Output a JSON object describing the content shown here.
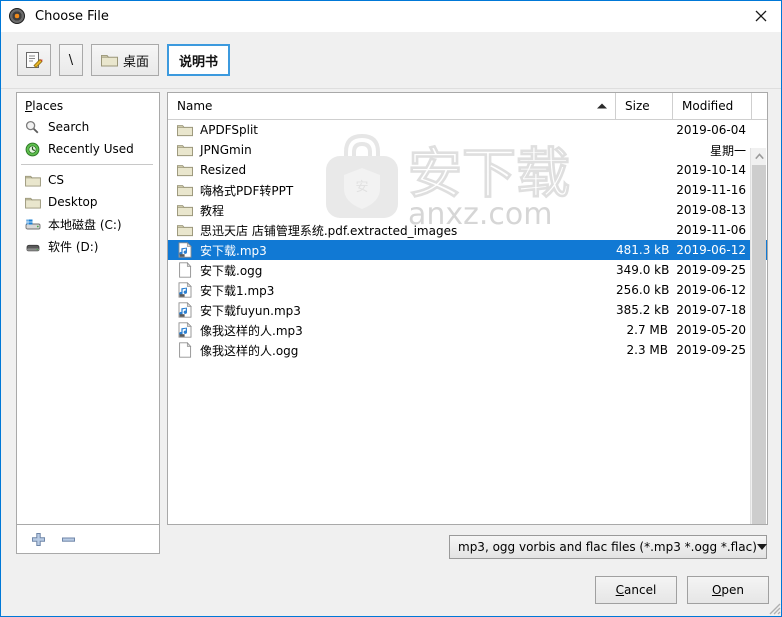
{
  "window": {
    "title": "Choose File",
    "app_icon": "record-disc-icon",
    "close_label": "×"
  },
  "toolbar": {
    "buttons": [
      {
        "name": "type-location-button",
        "icon": "pencil-edit-icon",
        "label": ""
      },
      {
        "name": "path-root-button",
        "icon": "",
        "label": "\\"
      },
      {
        "name": "path-desktop-button",
        "icon": "folder-icon",
        "label": "桌面"
      },
      {
        "name": "path-current-button",
        "icon": "",
        "label": "说明书",
        "active": true
      }
    ]
  },
  "sidebar": {
    "header": "Places",
    "header_accel": "P",
    "items": [
      {
        "label": "Search",
        "icon": "search-icon"
      },
      {
        "label": "Recently Used",
        "icon": "recent-clock-icon"
      },
      {
        "label": "CS",
        "icon": "folder-icon"
      },
      {
        "label": "Desktop",
        "icon": "folder-icon"
      },
      {
        "label": "本地磁盘 (C:)",
        "icon": "harddisk-icon"
      },
      {
        "label": "软件 (D:)",
        "icon": "drive-icon"
      }
    ],
    "add_button": "+",
    "remove_button": "−"
  },
  "filelist": {
    "columns": {
      "name": "Name",
      "size": "Size",
      "modified": "Modified"
    },
    "sort_column": "Name",
    "sort_direction": "ascending",
    "rows": [
      {
        "name": "APDFSplit",
        "size": "",
        "modified": "2019-06-04",
        "icon": "folder-icon",
        "selected": false
      },
      {
        "name": "JPNGmin",
        "size": "",
        "modified": "星期一",
        "icon": "folder-icon",
        "selected": false
      },
      {
        "name": "Resized",
        "size": "",
        "modified": "2019-10-14",
        "icon": "folder-icon",
        "selected": false
      },
      {
        "name": "嗨格式PDF转PPT",
        "size": "",
        "modified": "2019-11-16",
        "icon": "folder-icon",
        "selected": false
      },
      {
        "name": "教程",
        "size": "",
        "modified": "2019-08-13",
        "icon": "folder-icon",
        "selected": false
      },
      {
        "name": "思迅天店 店铺管理系统.pdf.extracted_images",
        "size": "",
        "modified": "2019-11-06",
        "icon": "folder-icon",
        "selected": false
      },
      {
        "name": "安下载.mp3",
        "size": "481.3 kB",
        "modified": "2019-06-12",
        "icon": "audio-file-icon",
        "selected": true
      },
      {
        "name": "安下载.ogg",
        "size": "349.0 kB",
        "modified": "2019-09-25",
        "icon": "generic-file-icon",
        "selected": false
      },
      {
        "name": "安下载1.mp3",
        "size": "256.0 kB",
        "modified": "2019-06-12",
        "icon": "audio-file-icon",
        "selected": false
      },
      {
        "name": "安下载fuyun.mp3",
        "size": "385.2 kB",
        "modified": "2019-07-18",
        "icon": "audio-file-icon",
        "selected": false
      },
      {
        "name": "像我这样的人.mp3",
        "size": "2.7 MB",
        "modified": "2019-05-20",
        "icon": "audio-file-icon",
        "selected": false
      },
      {
        "name": "像我这样的人.ogg",
        "size": "2.3 MB",
        "modified": "2019-09-25",
        "icon": "generic-file-icon",
        "selected": false
      }
    ]
  },
  "watermark": {
    "cn_text": "安下载",
    "domain_text": "anxz.com",
    "badge_text": "安"
  },
  "footer": {
    "filter_value": "mp3, ogg vorbis and flac files (*.mp3 *.ogg *.flac)",
    "cancel_label": "Cancel",
    "cancel_accel": "C",
    "open_label": "Open",
    "open_accel": "O"
  },
  "colors": {
    "selection": "#1179d4",
    "accent_border": "#0078d7",
    "active_tab_border": "#3c9ade",
    "window_bg": "#f0f0f0"
  }
}
